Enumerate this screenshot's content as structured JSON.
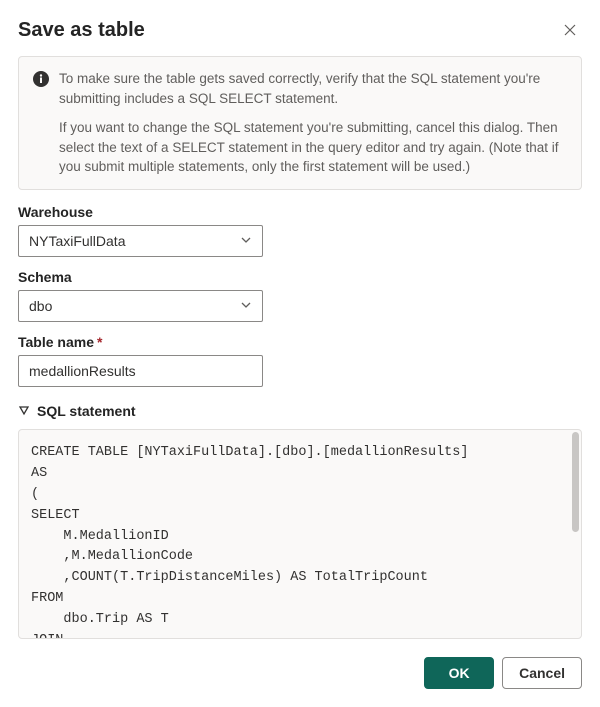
{
  "dialog": {
    "title": "Save as table",
    "info_p1": "To make sure the table gets saved correctly, verify that the SQL statement you're submitting includes a SQL SELECT statement.",
    "info_p2": "If you want to change the SQL statement you're submitting, cancel this dialog. Then select the text of a SELECT statement in the query editor and try again. (Note that if you submit multiple statements, only the first statement will be used.)"
  },
  "fields": {
    "warehouse_label": "Warehouse",
    "warehouse_value": "NYTaxiFullData",
    "schema_label": "Schema",
    "schema_value": "dbo",
    "table_name_label": "Table name",
    "table_name_value": "medallionResults"
  },
  "sql": {
    "section_label": "SQL statement",
    "code": "CREATE TABLE [NYTaxiFullData].[dbo].[medallionResults]\nAS\n(\nSELECT\n    M.MedallionID\n    ,M.MedallionCode\n    ,COUNT(T.TripDistanceMiles) AS TotalTripCount\nFROM\n    dbo.Trip AS T\nJOIN"
  },
  "buttons": {
    "ok": "OK",
    "cancel": "Cancel"
  }
}
